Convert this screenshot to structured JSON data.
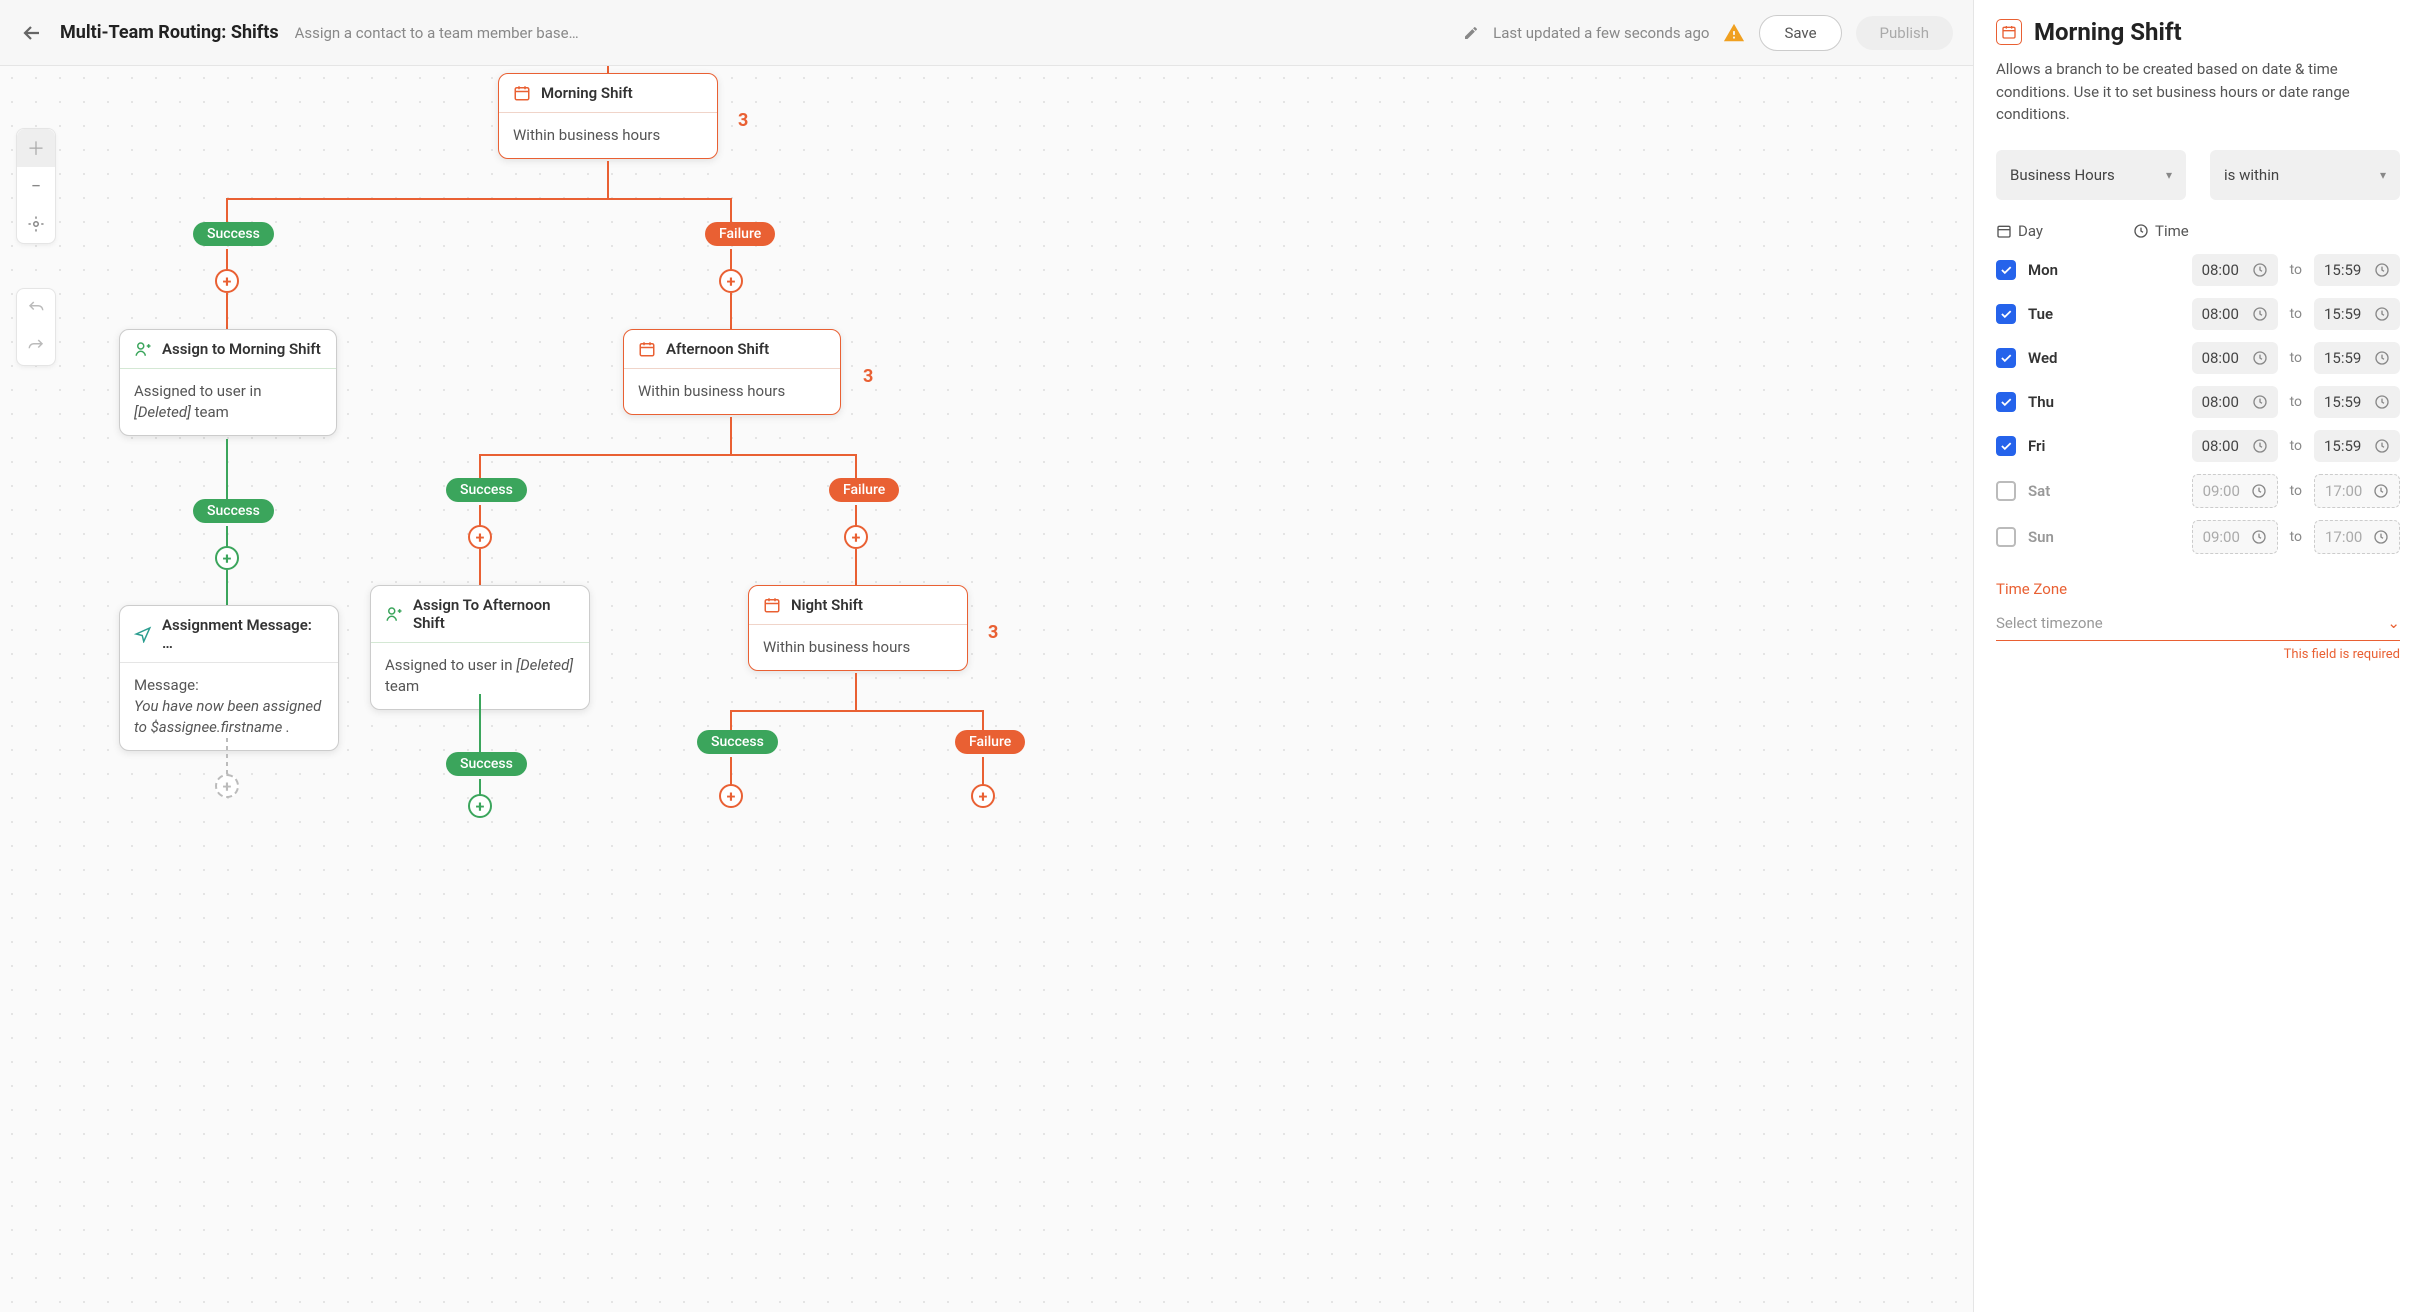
{
  "header": {
    "title": "Multi-Team Routing: Shifts",
    "subtitle": "Assign a contact to a team member based…",
    "last_updated": "Last updated a few seconds ago",
    "save_label": "Save",
    "publish_label": "Publish"
  },
  "nodes": {
    "morning": {
      "title": "Morning Shift",
      "body": "Within business hours",
      "badge": "3"
    },
    "assign_morning": {
      "title": "Assign to Morning Shift",
      "body_prefix": "Assigned to user in ",
      "body_deleted": "[Deleted]",
      "body_suffix": " team"
    },
    "afternoon": {
      "title": "Afternoon Shift",
      "body": "Within business hours",
      "badge": "3"
    },
    "assign_afternoon": {
      "title": "Assign To Afternoon Shift",
      "body_prefix": "Assigned to user in ",
      "body_deleted": "[Deleted]",
      "body_suffix": " team"
    },
    "night": {
      "title": "Night Shift",
      "body": "Within business hours",
      "badge": "3"
    },
    "message": {
      "title": "Assignment Message: …",
      "body_label": "Message:",
      "body_msg": "You have now been assigned to $assignee.firstname ."
    }
  },
  "pills": {
    "success": "Success",
    "failure": "Failure"
  },
  "panel": {
    "title": "Morning Shift",
    "desc": "Allows a branch to be created based on date & time conditions. Use it to set business hours or date range conditions.",
    "select1": "Business Hours",
    "select2": "is within",
    "day_label": "Day",
    "time_label": "Time",
    "to_label": "to",
    "days": [
      {
        "name": "Mon",
        "enabled": true,
        "from": "08:00",
        "to": "15:59"
      },
      {
        "name": "Tue",
        "enabled": true,
        "from": "08:00",
        "to": "15:59"
      },
      {
        "name": "Wed",
        "enabled": true,
        "from": "08:00",
        "to": "15:59"
      },
      {
        "name": "Thu",
        "enabled": true,
        "from": "08:00",
        "to": "15:59"
      },
      {
        "name": "Fri",
        "enabled": true,
        "from": "08:00",
        "to": "15:59"
      },
      {
        "name": "Sat",
        "enabled": false,
        "from": "09:00",
        "to": "17:00"
      },
      {
        "name": "Sun",
        "enabled": false,
        "from": "09:00",
        "to": "17:00"
      }
    ],
    "tz_label": "Time Zone",
    "tz_placeholder": "Select timezone",
    "tz_error": "This field is required"
  }
}
